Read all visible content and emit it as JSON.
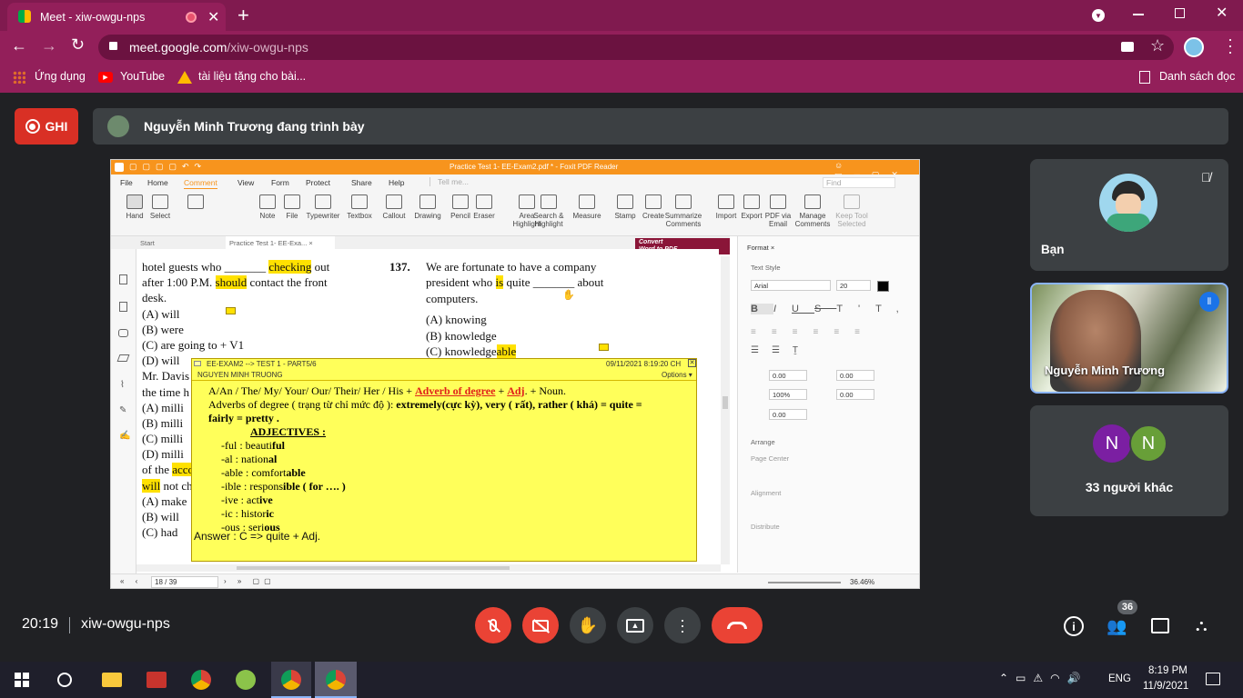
{
  "browser": {
    "tab_title": "Meet - xiw-owgu-nps",
    "url_host": "meet.google.com",
    "url_path": "/xiw-owgu-nps",
    "bookmarks": [
      "Ứng dụng",
      "YouTube",
      "tài liệu tặng cho bài..."
    ],
    "reading_list": "Danh sách đọc"
  },
  "meet": {
    "rec_label": "GHI",
    "presenting": "Nguyễn Minh Trương đang trình bày",
    "self_name": "Bạn",
    "speaker_name": "Nguyễn Minh Trương",
    "others_label": "33 người khác",
    "others_initials": [
      "N",
      "N"
    ],
    "clock": "20:19",
    "meeting_code": "xiw-owgu-nps",
    "participant_count": "36"
  },
  "foxit": {
    "title": "Practice Test 1- EE-Exam2.pdf * - Foxit PDF Reader",
    "search_placeholder": "Tell me...",
    "find_placeholder": "Find",
    "menu": [
      "File",
      "Home",
      "Comment",
      "View",
      "Form",
      "Protect",
      "Share",
      "Help"
    ],
    "ribbon": [
      {
        "l1": "Hand",
        "l2": ""
      },
      {
        "l1": "Select",
        "l2": ""
      },
      {
        "l1": "",
        "l2": ""
      },
      {
        "l1": "Note",
        "l2": ""
      },
      {
        "l1": "File",
        "l2": ""
      },
      {
        "l1": "Typewriter",
        "l2": ""
      },
      {
        "l1": "Textbox",
        "l2": ""
      },
      {
        "l1": "Callout",
        "l2": ""
      },
      {
        "l1": "Drawing",
        "l2": ""
      },
      {
        "l1": "Pencil",
        "l2": ""
      },
      {
        "l1": "Eraser",
        "l2": ""
      },
      {
        "l1": "Area",
        "l2": "Highlight"
      },
      {
        "l1": "Search &",
        "l2": "Highlight"
      },
      {
        "l1": "Measure",
        "l2": ""
      },
      {
        "l1": "Stamp",
        "l2": ""
      },
      {
        "l1": "Create",
        "l2": ""
      },
      {
        "l1": "Summarize",
        "l2": "Comments"
      },
      {
        "l1": "Import",
        "l2": ""
      },
      {
        "l1": "Export",
        "l2": ""
      },
      {
        "l1": "PDF via",
        "l2": "Email"
      },
      {
        "l1": "Manage",
        "l2": "Comments"
      },
      {
        "l1": "Keep Tool",
        "l2": "Selected"
      }
    ],
    "doc_tabs": [
      "Start",
      "Practice Test 1- EE-Exa..."
    ],
    "convert_label": "Convert",
    "convert_sub": "Word to PDF",
    "page_indicator": "18 / 39",
    "zoom": "36.46%",
    "format_panel": {
      "tab": "Format",
      "text_style": "Text Style",
      "font": "Arial",
      "size": "20",
      "spacing": [
        "0.00",
        "0.00",
        "100%",
        "0.00",
        "0.00"
      ],
      "arrange": "Arrange",
      "page_center": "Page Center",
      "alignment": "Alignment",
      "distribute": "Distribute"
    }
  },
  "pdf": {
    "left_lines": [
      {
        "pre": "hotel guests who _______ ",
        "hl": "checking",
        "post": " out"
      },
      {
        "pre": "after 1:00 P.M. ",
        "hl": "should",
        "post": " contact the front"
      },
      {
        "pre": "desk.",
        "hl": "",
        "post": ""
      },
      {
        "pre": "(A)   will",
        "hl": "",
        "post": ""
      },
      {
        "pre": "(B)   were",
        "hl": "",
        "post": ""
      },
      {
        "pre": "(C)   are going to + V1",
        "hl": "",
        "post": ""
      },
      {
        "pre": "(D)   will",
        "hl": "",
        "post": ""
      },
      {
        "pre": "Mr. Davis",
        "hl": "",
        "post": ""
      },
      {
        "pre": "the time h",
        "hl": "",
        "post": ""
      },
      {
        "pre": "(A)   milli",
        "hl": "",
        "post": ""
      },
      {
        "pre": "(B)   milli",
        "hl": "",
        "post": ""
      },
      {
        "pre": "(C)   milli",
        "hl": "",
        "post": ""
      },
      {
        "pre": "(D)   milli",
        "hl": "",
        "post": ""
      },
      {
        "pre": "of the ",
        "hl": "acco",
        "post": ""
      },
      {
        "pre": "",
        "hl": "will",
        "post": " not ch"
      },
      {
        "pre": "(A)   make",
        "hl": "",
        "post": ""
      },
      {
        "pre": "(B)   will",
        "hl": "",
        "post": ""
      },
      {
        "pre": "(C)   had",
        "hl": "",
        "post": ""
      }
    ],
    "q_num": "137.",
    "right_lines": [
      {
        "pre": "We are fortunate to have a company",
        "hl": "",
        "post": ""
      },
      {
        "pre": "president who ",
        "hl": "is",
        "post": " quite _______ about"
      },
      {
        "pre": "computers.",
        "hl": "",
        "post": ""
      },
      {
        "pre": "(A)   knowing",
        "hl": "",
        "post": ""
      },
      {
        "pre": "(B)   knowledge",
        "hl": "",
        "post": ""
      },
      {
        "pre": "(C)   knowledge",
        "hl": "able",
        "post": ""
      }
    ]
  },
  "note": {
    "header": "EE-EXAM2 --> TEST 1 - PART5/6",
    "date": "09/11/2021 8:19:20 CH",
    "author": "NGUYEN MINH TRUONG",
    "options": "Options",
    "line1_pre": "A/An / The/ My/ Your/ Our/ Their/ Her / His + ",
    "line1_red1": "Adverb of degree",
    "line1_mid": " + ",
    "line1_red2": "Adj",
    "line1_post": ". + Noun.",
    "line2_pre": "Adverbs of degree ( trạng từ chỉ mức độ ): ",
    "line2_bold": "extremely(cực kỳ), very ( rất), rather ( khá) = quite =",
    "line3": "fairly = pretty .",
    "adj_title": "ADJECTIVES :",
    "suffixes": [
      {
        "s": "-ful : beauti",
        "b": "ful",
        "t": ""
      },
      {
        "s": "-al : nation",
        "b": "al",
        "t": ""
      },
      {
        "s": "-able : comfort",
        "b": "able",
        "t": ""
      },
      {
        "s": "-ible : respons",
        "b": "ible ( for …. )",
        "t": ""
      },
      {
        "s": "-ive : act",
        "b": "ive",
        "t": ""
      },
      {
        "s": "-ic : histor",
        "b": "ic",
        "t": ""
      },
      {
        "s": "-ous : seri",
        "b": "ous",
        "t": ""
      }
    ],
    "answer": "Answer : C => quite + Adj."
  },
  "taskbar": {
    "lang": "ENG",
    "time": "8:19 PM",
    "date": "11/9/2021"
  },
  "colors": {
    "rec": "#d93025",
    "end_call": "#ea4335",
    "note_bg": "#ffff5a",
    "highlight": "#ffe100",
    "foxit_orange": "#f7941d"
  }
}
